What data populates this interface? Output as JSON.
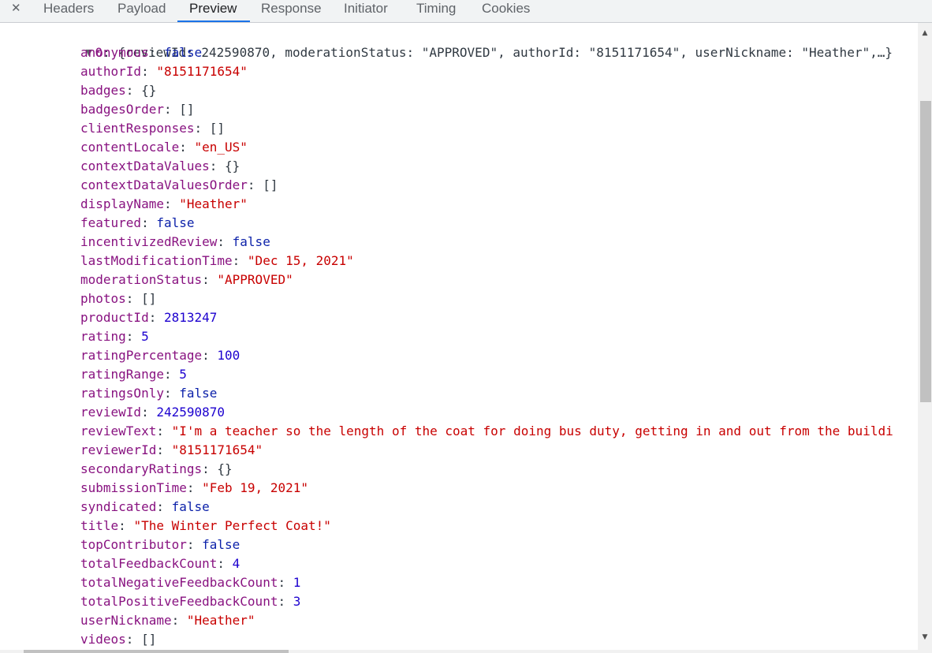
{
  "tabs": {
    "close_glyph": "✕",
    "items": [
      "Headers",
      "Payload",
      "Preview",
      "Response",
      "Initiator",
      "Timing",
      "Cookies"
    ],
    "active": "Preview"
  },
  "preview": {
    "summary": {
      "toggle_glyph": "▼",
      "index": "0",
      "text": "{reviewId: 242590870, moderationStatus: \"APPROVED\", authorId: \"8151171654\", userNickname: \"Heather\",…}"
    },
    "properties": [
      {
        "key": "anonymous",
        "value": "false",
        "type": "bool"
      },
      {
        "key": "authorId",
        "value": "\"8151171654\"",
        "type": "str"
      },
      {
        "key": "badges",
        "value": "{}",
        "type": "punct"
      },
      {
        "key": "badgesOrder",
        "value": "[]",
        "type": "punct"
      },
      {
        "key": "clientResponses",
        "value": "[]",
        "type": "punct"
      },
      {
        "key": "contentLocale",
        "value": "\"en_US\"",
        "type": "str"
      },
      {
        "key": "contextDataValues",
        "value": "{}",
        "type": "punct"
      },
      {
        "key": "contextDataValuesOrder",
        "value": "[]",
        "type": "punct"
      },
      {
        "key": "displayName",
        "value": "\"Heather\"",
        "type": "str"
      },
      {
        "key": "featured",
        "value": "false",
        "type": "bool"
      },
      {
        "key": "incentivizedReview",
        "value": "false",
        "type": "bool"
      },
      {
        "key": "lastModificationTime",
        "value": "\"Dec 15, 2021\"",
        "type": "str"
      },
      {
        "key": "moderationStatus",
        "value": "\"APPROVED\"",
        "type": "str"
      },
      {
        "key": "photos",
        "value": "[]",
        "type": "punct"
      },
      {
        "key": "productId",
        "value": "2813247",
        "type": "num"
      },
      {
        "key": "rating",
        "value": "5",
        "type": "num"
      },
      {
        "key": "ratingPercentage",
        "value": "100",
        "type": "num"
      },
      {
        "key": "ratingRange",
        "value": "5",
        "type": "num"
      },
      {
        "key": "ratingsOnly",
        "value": "false",
        "type": "bool"
      },
      {
        "key": "reviewId",
        "value": "242590870",
        "type": "num"
      },
      {
        "key": "reviewText",
        "value": "\"I'm a teacher so the length of the coat for doing bus duty, getting in and out from the buildi",
        "type": "str"
      },
      {
        "key": "reviewerId",
        "value": "\"8151171654\"",
        "type": "str"
      },
      {
        "key": "secondaryRatings",
        "value": "{}",
        "type": "punct"
      },
      {
        "key": "submissionTime",
        "value": "\"Feb 19, 2021\"",
        "type": "str"
      },
      {
        "key": "syndicated",
        "value": "false",
        "type": "bool"
      },
      {
        "key": "title",
        "value": "\"The Winter Perfect Coat!\"",
        "type": "str"
      },
      {
        "key": "topContributor",
        "value": "false",
        "type": "bool"
      },
      {
        "key": "totalFeedbackCount",
        "value": "4",
        "type": "num"
      },
      {
        "key": "totalNegativeFeedbackCount",
        "value": "1",
        "type": "num"
      },
      {
        "key": "totalPositiveFeedbackCount",
        "value": "3",
        "type": "num"
      },
      {
        "key": "userNickname",
        "value": "\"Heather\"",
        "type": "str"
      },
      {
        "key": "videos",
        "value": "[]",
        "type": "punct"
      }
    ]
  },
  "scrollbar": {
    "up_glyph": "▲",
    "down_glyph": "▼"
  },
  "colors": {
    "key": "#881280",
    "string": "#c80000",
    "number": "#1c00cf",
    "boolean": "#0d22aa",
    "active_tab_underline": "#1a73e8"
  }
}
